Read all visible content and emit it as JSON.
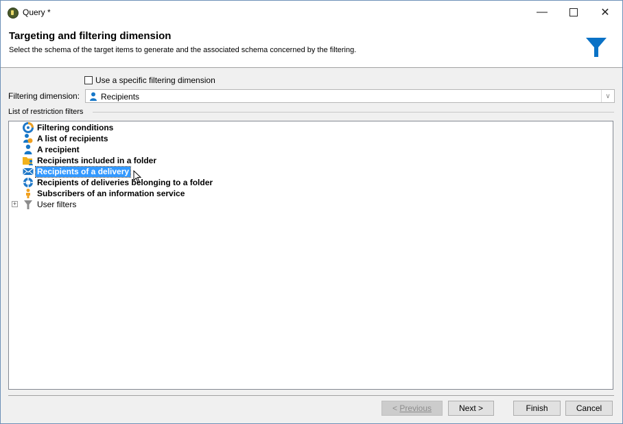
{
  "window": {
    "title": "Query *"
  },
  "header": {
    "title": "Targeting and filtering dimension",
    "description": "Select the schema of the target items to  generate and the associated schema concerned by the filtering."
  },
  "form": {
    "checkbox_label": "Use a specific filtering dimension",
    "checkbox_checked": false,
    "dimension_label": "Filtering dimension:",
    "dimension_value": "Recipients",
    "group_label": "List of restriction filters"
  },
  "filters": [
    {
      "label": "Filtering conditions",
      "icon": "filtering-conditions-icon"
    },
    {
      "label": "A list of recipients",
      "icon": "recipient-list-icon"
    },
    {
      "label": "A recipient",
      "icon": "recipient-icon"
    },
    {
      "label": "Recipients included in a folder",
      "icon": "folder-recipients-icon"
    },
    {
      "label": "Recipients of a delivery",
      "icon": "delivery-envelope-icon",
      "selected": true
    },
    {
      "label": "Recipients of deliveries belonging to a folder",
      "icon": "delivery-folder-icon"
    },
    {
      "label": "Subscribers of an information service",
      "icon": "subscriber-icon"
    },
    {
      "label": "User filters",
      "icon": "user-filter-icon",
      "expandable": true
    }
  ],
  "buttons": {
    "previous": "Previous",
    "previous_prefix": "< ",
    "next": "Next >",
    "finish": "Finish",
    "cancel": "Cancel"
  },
  "colors": {
    "accent": "#0a72c6",
    "selection": "#3399ff"
  }
}
